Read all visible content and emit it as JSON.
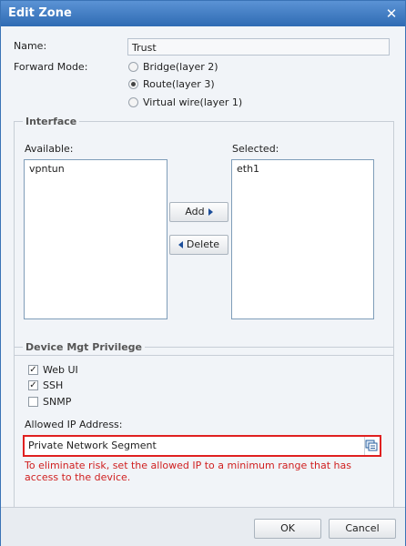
{
  "window": {
    "title": "Edit Zone"
  },
  "form": {
    "name_label": "Name:",
    "name_value": "Trust",
    "forward_mode_label": "Forward Mode:",
    "forward_modes": [
      {
        "label": "Bridge(layer 2)",
        "selected": false
      },
      {
        "label": "Route(layer 3)",
        "selected": true
      },
      {
        "label": "Virtual wire(layer 1)",
        "selected": false
      }
    ]
  },
  "interface": {
    "legend": "Interface",
    "available_label": "Available:",
    "available_items": [
      "vpntun"
    ],
    "selected_label": "Selected:",
    "selected_items": [
      "eth1"
    ],
    "add_label": "Add",
    "delete_label": "Delete"
  },
  "device_mgt": {
    "legend": "Device Mgt Privilege",
    "options": [
      {
        "label": "Web UI",
        "checked": true
      },
      {
        "label": "SSH",
        "checked": true
      },
      {
        "label": "SNMP",
        "checked": false
      }
    ],
    "allowed_ip_label": "Allowed IP Address:",
    "allowed_ip_value": "Private Network Segment",
    "warning": "To eliminate risk, set the allowed IP to a minimum range that has access to the device."
  },
  "footer": {
    "ok_label": "OK",
    "cancel_label": "Cancel"
  },
  "colors": {
    "title_bar": "#2f6bb3",
    "warning": "#d02020",
    "highlight_border": "#e02020"
  }
}
